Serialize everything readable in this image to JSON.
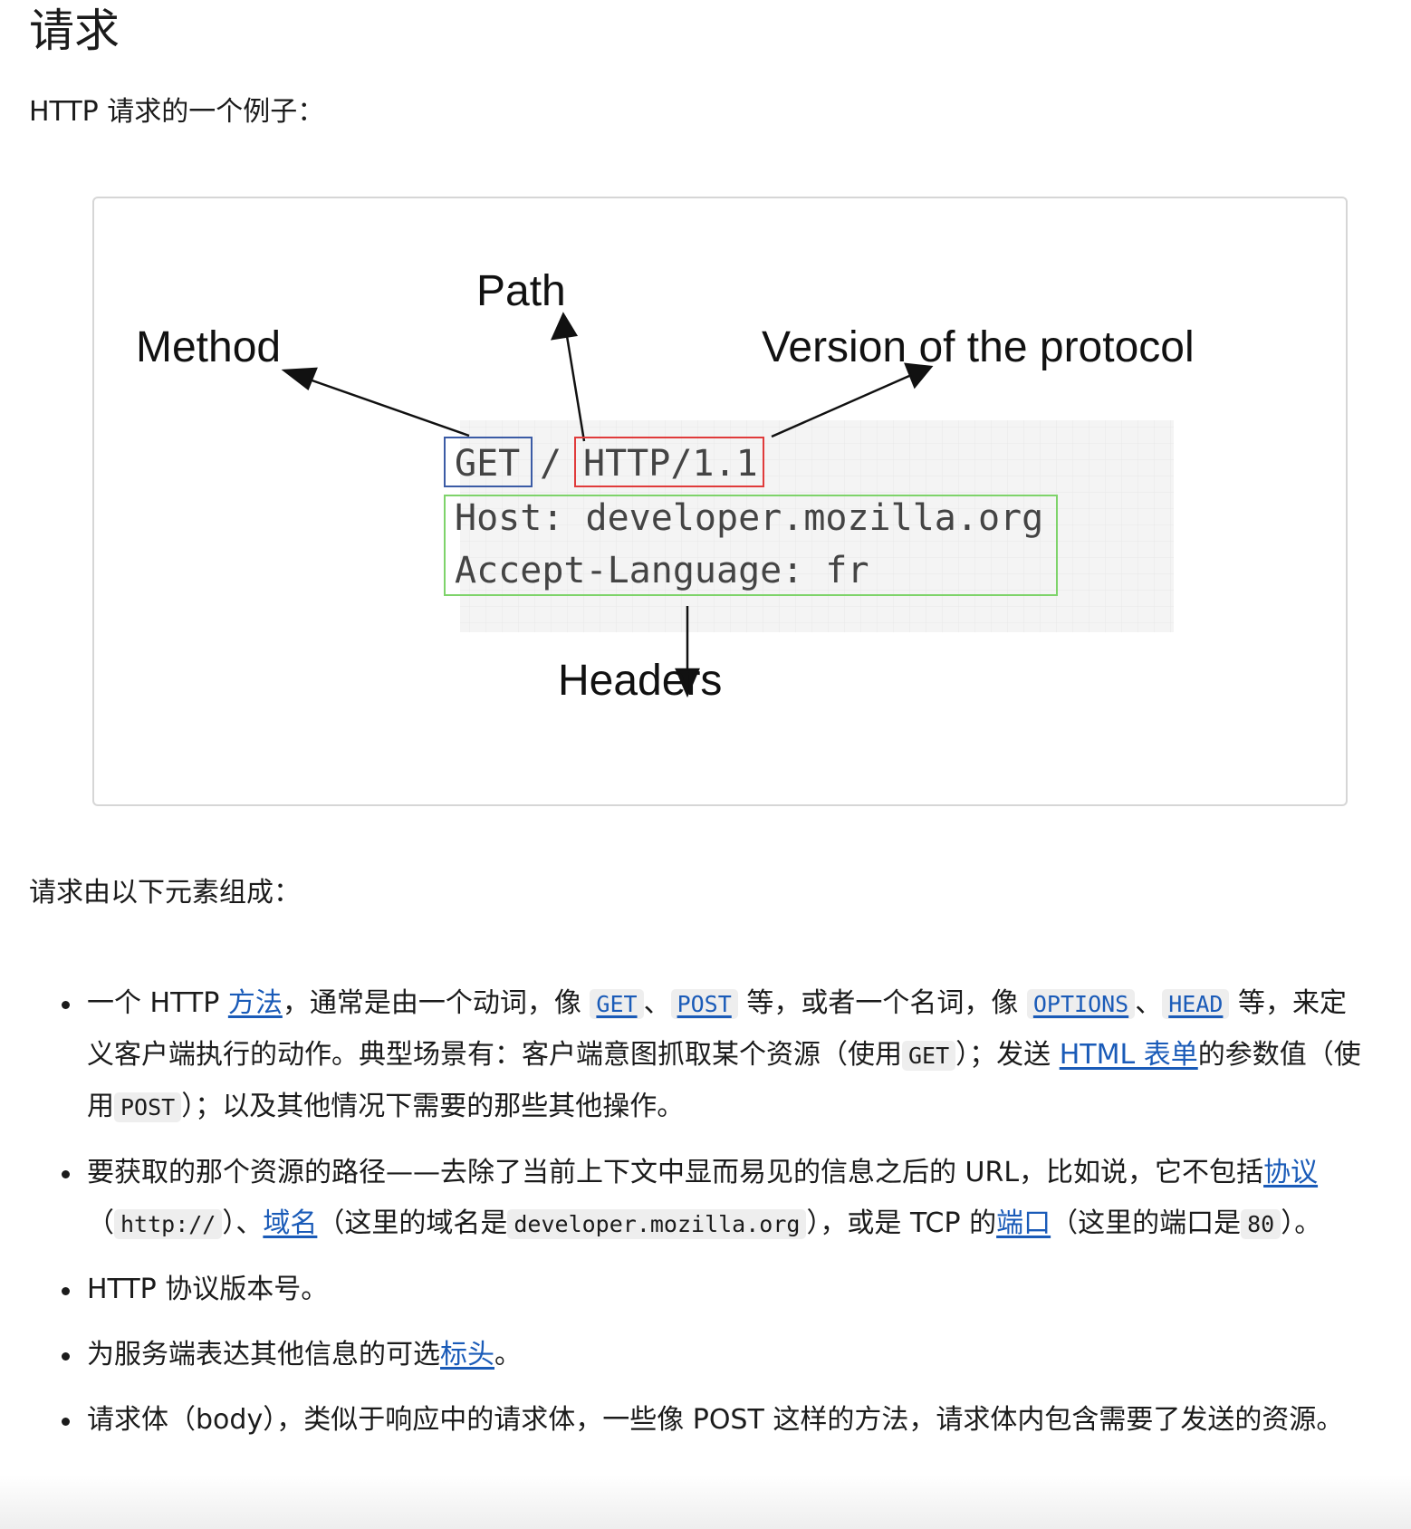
{
  "heading": "请求",
  "intro": "HTTP 请求的一个例子：",
  "diagram": {
    "labels": {
      "method": "Method",
      "path": "Path",
      "version": "Version of the protocol",
      "headers": "Headers"
    },
    "request": {
      "method": "GET",
      "path": "/",
      "version": "HTTP/1.1",
      "header_lines": [
        "Host: developer.mozilla.org",
        "Accept-Language: fr"
      ]
    },
    "colors": {
      "method_box": "#3b5ba5",
      "version_box": "#e03b3b",
      "headers_box": "#7ed36a",
      "code_background": "#f4f4f4"
    }
  },
  "lead": "请求由以下元素组成：",
  "items": [
    {
      "p1": "一个 HTTP ",
      "link_method": "方法",
      "p2": "，通常是由一个动词，像 ",
      "code_get": "GET",
      "p3": "、",
      "code_post": "POST",
      "p4": " 等，或者一个名词，像 ",
      "code_options": "OPTIONS",
      "p5": "、",
      "code_head": "HEAD",
      "p6": " 等，来定义客户端执行的动作。典型场景有：客户端意图抓取某个资源（使用",
      "code_get2": "GET",
      "p7": "）；发送 ",
      "link_form": "HTML 表单",
      "p8": "的参数值（使用",
      "code_post2": "POST",
      "p9": "）；以及其他情况下需要的那些其他操作。"
    },
    {
      "p1": "要获取的那个资源的路径——去除了当前上下文中显而易见的信息之后的 URL，比如说，它不包括",
      "link_protocol": "协议",
      "p2": "（",
      "code_http": "http://",
      "p3": "）、",
      "link_domain": "域名",
      "p4": "（这里的域名是",
      "code_domain": "developer.mozilla.org",
      "p5": "），或是 TCP 的",
      "link_port": "端口",
      "p6": "（这里的端口是",
      "code_port": "80",
      "p7": "）。"
    },
    {
      "text": "HTTP 协议版本号。"
    },
    {
      "p1": "为服务端表达其他信息的可选",
      "link_headers": "标头",
      "p2": "。"
    },
    {
      "text": "请求体（body），类似于响应中的请求体，一些像 POST 这样的方法，请求体内包含需要了发送的资源。"
    }
  ]
}
